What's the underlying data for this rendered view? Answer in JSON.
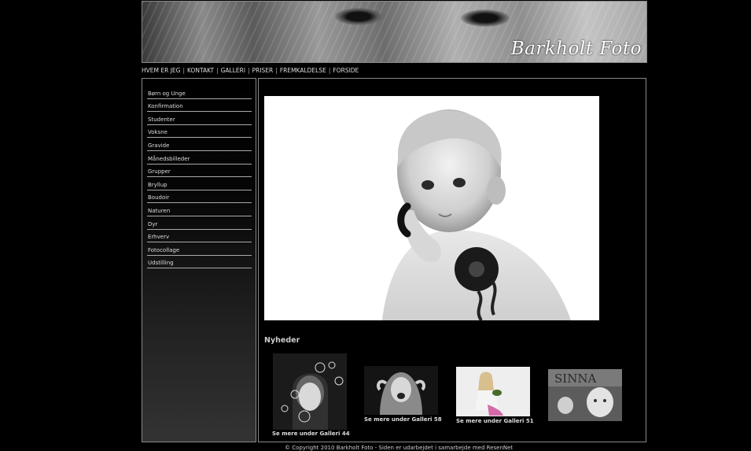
{
  "brand": {
    "title": "Barkholt Foto"
  },
  "topnav": {
    "items": [
      "HVEM ER JEG",
      "KONTAKT",
      "GALLERI",
      "PRISER",
      "FREMKALDELSE",
      "FORSIDE"
    ],
    "separator": "|"
  },
  "sidebar": {
    "items": [
      "Børn og Unge",
      "Konfirmation",
      "Studenter",
      "Voksne",
      "Gravide",
      "Månedsbilleder",
      "Grupper",
      "Bryllup",
      "Boudoir",
      "Naturen",
      "Dyr",
      "Erhverv",
      "Fotocollage",
      "Udstilling"
    ]
  },
  "main": {
    "news_heading": "Nyheder",
    "thumbs": [
      {
        "caption": "Se mere under Galleri 44"
      },
      {
        "caption": "Se mere under Galleri 58"
      },
      {
        "caption": "Se mere under Galleri 51"
      },
      {
        "caption": ""
      }
    ],
    "collage_text": "SINNA"
  },
  "footer": {
    "text": "© Copyright 2010 Barkholt Foto - Siden er udarbejdet i samarbejde med ResenNet"
  }
}
